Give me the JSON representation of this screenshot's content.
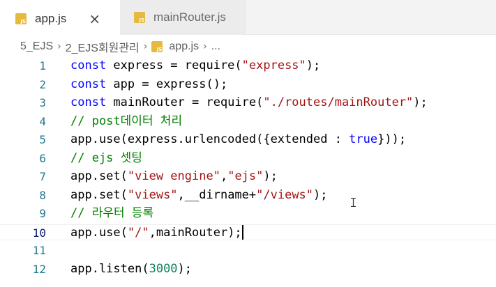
{
  "tabs": [
    {
      "label": "app.js",
      "icon": "JS",
      "active": true,
      "close": "×"
    },
    {
      "label": "mainRouter.js",
      "icon": "JS",
      "active": false
    }
  ],
  "breadcrumb": {
    "items": [
      "5_EJS",
      "2_EJS회원관리",
      "app.js",
      "..."
    ],
    "separator": "›"
  },
  "editor": {
    "lines": [
      {
        "n": "1",
        "tokens": [
          {
            "t": "const",
            "c": "kw"
          },
          {
            "t": " express = require("
          },
          {
            "t": "\"express\"",
            "c": "str"
          },
          {
            "t": ");"
          }
        ]
      },
      {
        "n": "2",
        "tokens": [
          {
            "t": "const",
            "c": "kw"
          },
          {
            "t": " app = express();"
          }
        ]
      },
      {
        "n": "3",
        "tokens": [
          {
            "t": "const",
            "c": "kw"
          },
          {
            "t": " mainRouter = require("
          },
          {
            "t": "\"./routes/mainRouter\"",
            "c": "str"
          },
          {
            "t": ");"
          }
        ]
      },
      {
        "n": "4",
        "tokens": [
          {
            "t": "// post데이터 처리",
            "c": "cm"
          }
        ]
      },
      {
        "n": "5",
        "tokens": [
          {
            "t": "app.use(express.urlencoded({extended : "
          },
          {
            "t": "true",
            "c": "kw"
          },
          {
            "t": "}));"
          }
        ]
      },
      {
        "n": "6",
        "tokens": [
          {
            "t": "// ejs 셋팅",
            "c": "cm"
          }
        ]
      },
      {
        "n": "7",
        "tokens": [
          {
            "t": "app.set("
          },
          {
            "t": "\"view engine\"",
            "c": "str"
          },
          {
            "t": ","
          },
          {
            "t": "\"ejs\"",
            "c": "str"
          },
          {
            "t": ");"
          }
        ]
      },
      {
        "n": "8",
        "tokens": [
          {
            "t": "app.set("
          },
          {
            "t": "\"views\"",
            "c": "str"
          },
          {
            "t": ",__dirname+"
          },
          {
            "t": "\"/views\"",
            "c": "str"
          },
          {
            "t": ");"
          }
        ]
      },
      {
        "n": "9",
        "tokens": [
          {
            "t": "// 라우터 등록",
            "c": "cm"
          }
        ]
      },
      {
        "n": "10",
        "tokens": [
          {
            "t": "app.use("
          },
          {
            "t": "\"/\"",
            "c": "str"
          },
          {
            "t": ",mainRouter);"
          }
        ],
        "current": true
      },
      {
        "n": "11",
        "tokens": []
      },
      {
        "n": "12",
        "tokens": [
          {
            "t": "app.listen("
          },
          {
            "t": "3000",
            "c": "num"
          },
          {
            "t": ");"
          }
        ]
      }
    ]
  },
  "colors": {
    "keyword": "#0000ff",
    "string": "#a31515",
    "comment": "#008000",
    "number": "#098658",
    "line_number": "#237893",
    "js_icon": "#e6ba3f"
  }
}
